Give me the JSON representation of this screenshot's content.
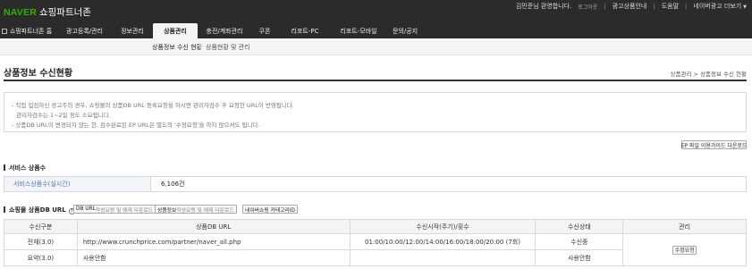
{
  "header": {
    "logo_brand": "NAVER",
    "logo_service": "쇼핑파트너존",
    "greeting": "김민준님 환영합니다.",
    "logout": "로그아웃",
    "links": [
      "광고상품안내",
      "도움말",
      "네이버광고 더보기"
    ]
  },
  "mainnav": {
    "home": "쇼핑파트너존 홈",
    "items": [
      "광고등록/관리",
      "정보관리",
      "상품관리",
      "충전/계좌관리",
      "쿠폰",
      "리포트-PC",
      "리포트-모바일",
      "문의/공지"
    ],
    "active_index": 2
  },
  "subnav": {
    "items": [
      "상품정보 수신 현황",
      "상품현황 및 관리"
    ]
  },
  "page": {
    "title": "상품정보 수신현황",
    "breadcrumb": "상품관리 > 상품정보 수신 현황"
  },
  "notice": {
    "lines": [
      "- 직접 입점하신 광고주의 경우, 쇼핑몰의 상품DB URL 등록요청을 하시면 관리자검수 후 요청한 URL이 반영됩니다.",
      "관리자검수는 1~2일 정도 소요됩니다.",
      "- 상품DB URL이 변경되지 않는 한, 검수완료된 EP URL은 별도의 '수정요청'을 하지 않으셔도 됩니다."
    ]
  },
  "guide_download": "EP 파일 이용가이드 다운로드",
  "service": {
    "section_title": "서비스 상품수",
    "label": "서비스상품수(실시간)",
    "value": "6,106건"
  },
  "db": {
    "section_title": "쇼핑몰 상품DB URL",
    "help": "?",
    "buttons": [
      {
        "bold": "DB URL",
        "rest": " 작성요령 및 예제 다운로드"
      },
      {
        "bold": "상품정보",
        "rest": " 작성요령 및 예제 다운로드"
      },
      {
        "bold": "네이버쇼핑 카테고리ID",
        "rest": ""
      }
    ],
    "columns": [
      "수신구분",
      "상품DB URL",
      "수신시작(주기)/횟수",
      "수신상태",
      "관리"
    ],
    "rows": [
      {
        "type": "전체(3.0)",
        "url": "http://www.crunchprice.com/partner/naver_all.php",
        "schedule": "01:00/10:00/12:00/14:00/16:00/18:00/20:00 (7회)",
        "status": "수신중"
      },
      {
        "type": "요약(3.0)",
        "url": "사용안함",
        "schedule": "",
        "status": "사용안함"
      }
    ],
    "manage_button": "수정요청"
  }
}
